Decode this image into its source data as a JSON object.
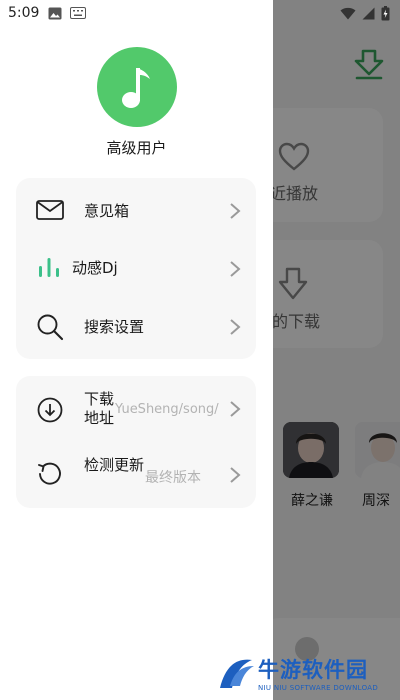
{
  "status_bar": {
    "time": "5:09"
  },
  "drawer": {
    "username": "高级用户",
    "avatar_icon": "music-note-icon",
    "avatar_color": "#52c96b",
    "menu_group_1": [
      {
        "label": "意见箱",
        "icon": "mail-icon"
      },
      {
        "label": "动感Dj",
        "icon": "equalizer-icon",
        "icon_color": "#3cc08a"
      },
      {
        "label": "搜索设置",
        "icon": "search-icon"
      }
    ],
    "menu_group_2": [
      {
        "label": "下载地址",
        "value": "YueSheng/song/",
        "icon": "download-circle-icon"
      },
      {
        "label": "检测更新",
        "value": "最终版本",
        "icon": "refresh-icon"
      }
    ]
  },
  "background": {
    "card_1_label": "近播放",
    "card_2_label": "的下载",
    "artists": [
      "薛之谦",
      "周深"
    ],
    "accent_color": "#3aa55c"
  },
  "watermark": {
    "title": "牛游软件园",
    "subtitle": "NIU NIU SOFTWARE DOWNLOAD"
  }
}
